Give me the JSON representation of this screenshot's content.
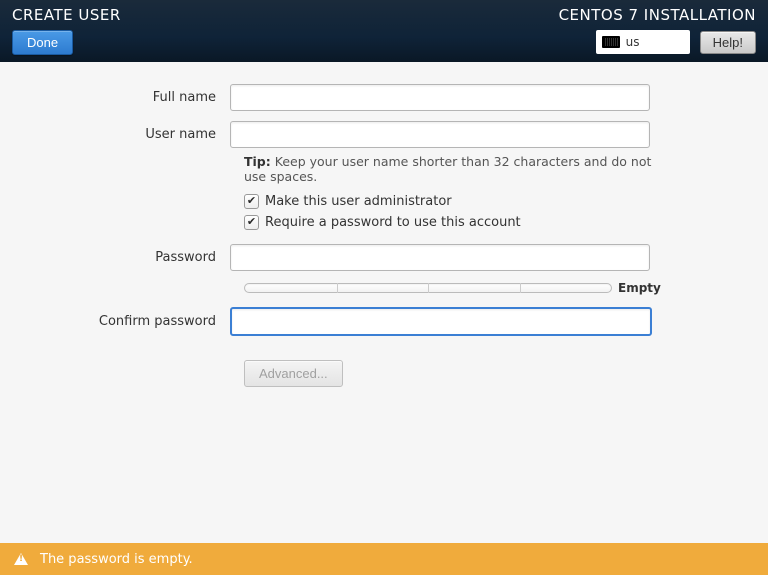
{
  "header": {
    "title_left": "CREATE USER",
    "title_right": "CENTOS 7 INSTALLATION",
    "done_label": "Done",
    "keyboard_layout": "us",
    "help_label": "Help!"
  },
  "form": {
    "full_name": {
      "label": "Full name",
      "value": ""
    },
    "user_name": {
      "label": "User name",
      "value": ""
    },
    "tip_prefix": "Tip:",
    "tip_text": " Keep your user name shorter than 32 characters and do not use spaces.",
    "make_admin": {
      "label": "Make this user administrator",
      "checked": true
    },
    "require_password": {
      "label": "Require a password to use this account",
      "checked": true
    },
    "password": {
      "label": "Password",
      "value": ""
    },
    "strength_label": "Empty",
    "confirm_password": {
      "label": "Confirm password",
      "value": ""
    },
    "advanced_label": "Advanced..."
  },
  "warning": {
    "message": "The password is empty."
  },
  "colors": {
    "accent": "#3b7fd4",
    "header_bg": "#0f2338",
    "warn_bg": "#f0ab3c"
  }
}
